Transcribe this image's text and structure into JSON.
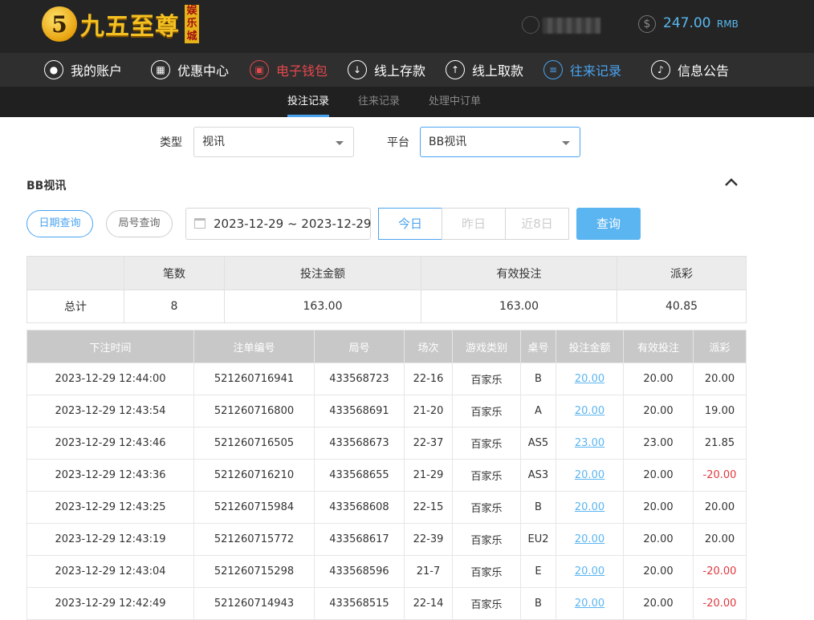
{
  "brand": {
    "badge": "5",
    "name": "九五至尊",
    "tag": [
      "娱",
      "乐",
      "城"
    ]
  },
  "account": {
    "balance": "247.00",
    "currency": "RMB"
  },
  "nav": [
    {
      "label": "我的账户",
      "icon": "user-icon",
      "active": false
    },
    {
      "label": "优惠中心",
      "icon": "gift-icon",
      "active": false
    },
    {
      "label": "电子钱包",
      "icon": "wallet-icon",
      "active": "red"
    },
    {
      "label": "线上存款",
      "icon": "deposit-icon",
      "active": false
    },
    {
      "label": "线上取款",
      "icon": "withdraw-icon",
      "active": false
    },
    {
      "label": "往来记录",
      "icon": "records-icon",
      "active": "blue"
    },
    {
      "label": "信息公告",
      "icon": "bell-icon",
      "active": false
    }
  ],
  "subnav": [
    "投注记录",
    "往来记录",
    "处理中订单"
  ],
  "filters": {
    "type_label": "类型",
    "type_value": "视讯",
    "platform_label": "平台",
    "platform_value": "BB视讯"
  },
  "section_title": "BB视讯",
  "query": {
    "date_query": "日期查询",
    "round_query": "局号查询",
    "date_range": "2023-12-29 ~ 2023-12-29",
    "quick": [
      "今日",
      "昨日",
      "近8日"
    ],
    "search": "查询"
  },
  "summary": {
    "headers": [
      "",
      "笔数",
      "投注金额",
      "有效投注",
      "派彩"
    ],
    "row": [
      "总计",
      "8",
      "163.00",
      "163.00",
      "40.85"
    ]
  },
  "detail": {
    "headers": [
      "下注时间",
      "注单编号",
      "局号",
      "场次",
      "游戏类别",
      "桌号",
      "投注金额",
      "有效投注",
      "派彩"
    ],
    "rows": [
      [
        "2023-12-29 12:44:00",
        "521260716941",
        "433568723",
        "22-16",
        "百家乐",
        "B",
        "20.00",
        "20.00",
        "20.00"
      ],
      [
        "2023-12-29 12:43:54",
        "521260716800",
        "433568691",
        "21-20",
        "百家乐",
        "A",
        "20.00",
        "20.00",
        "19.00"
      ],
      [
        "2023-12-29 12:43:46",
        "521260716505",
        "433568673",
        "22-37",
        "百家乐",
        "AS5",
        "23.00",
        "23.00",
        "21.85"
      ],
      [
        "2023-12-29 12:43:36",
        "521260716210",
        "433568655",
        "21-29",
        "百家乐",
        "AS3",
        "20.00",
        "20.00",
        "-20.00"
      ],
      [
        "2023-12-29 12:43:25",
        "521260715984",
        "433568608",
        "22-15",
        "百家乐",
        "B",
        "20.00",
        "20.00",
        "20.00"
      ],
      [
        "2023-12-29 12:43:19",
        "521260715772",
        "433568617",
        "22-39",
        "百家乐",
        "EU2",
        "20.00",
        "20.00",
        "20.00"
      ],
      [
        "2023-12-29 12:43:04",
        "521260715298",
        "433568596",
        "21-7",
        "百家乐",
        "E",
        "20.00",
        "20.00",
        "-20.00"
      ],
      [
        "2023-12-29 12:42:49",
        "521260714943",
        "433568515",
        "22-14",
        "百家乐",
        "B",
        "20.00",
        "20.00",
        "-20.00"
      ]
    ]
  },
  "colors": {
    "accent": "#4aa3ef",
    "negative": "#e0393e",
    "wallet": "#e5484d",
    "gold": "#f4c021"
  }
}
